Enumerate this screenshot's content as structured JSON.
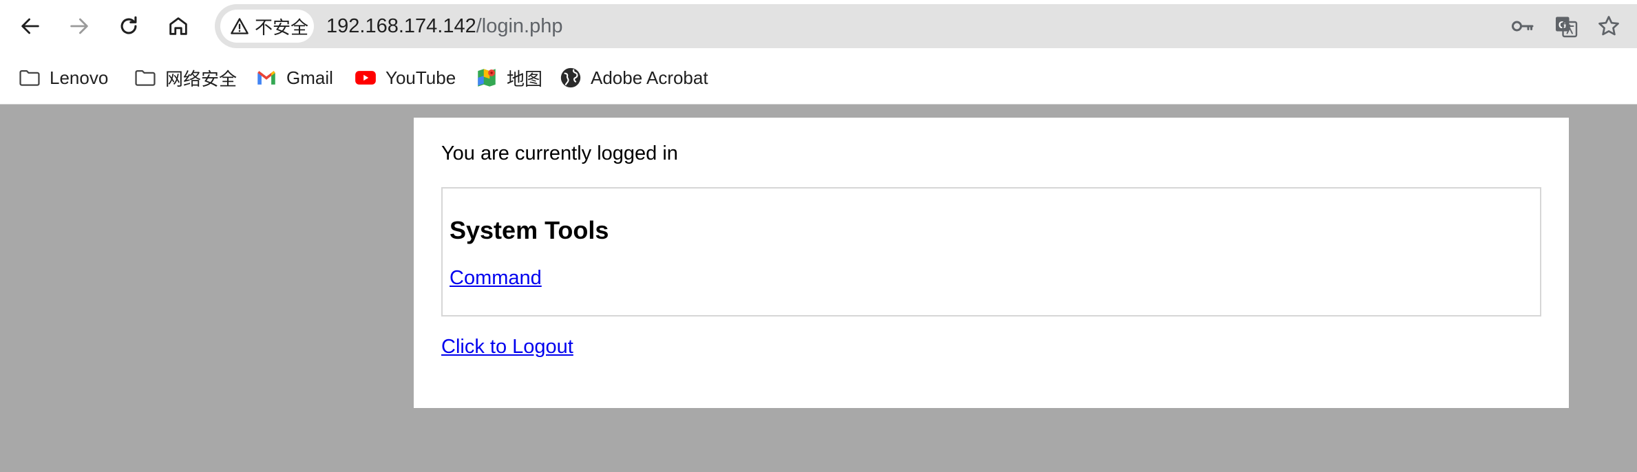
{
  "browser": {
    "security_label": "不安全",
    "url_host": "192.168.174.142",
    "url_path": "/login.php",
    "nav_icons": [
      "back-icon",
      "forward-icon",
      "reload-icon",
      "home-icon"
    ],
    "omnibox_icons": [
      "key-icon",
      "translate-icon",
      "star-icon"
    ],
    "bookmarks": [
      {
        "label": "Lenovo",
        "icon": "folder-icon"
      },
      {
        "label": "网络安全",
        "icon": "folder-icon"
      },
      {
        "label": "Gmail",
        "icon": "gmail-icon"
      },
      {
        "label": "YouTube",
        "icon": "youtube-icon"
      },
      {
        "label": "地图",
        "icon": "maps-icon"
      },
      {
        "label": "Adobe Acrobat",
        "icon": "globe-icon"
      }
    ]
  },
  "page": {
    "status_text": "You are currently logged in",
    "tools_heading": "System Tools",
    "command_link": "Command",
    "logout_link": "Click to Logout"
  },
  "colors": {
    "page_background": "#a8a8a8",
    "card_background": "#ffffff",
    "link": "#0000ee",
    "omnibox": "#e2e2e2"
  }
}
